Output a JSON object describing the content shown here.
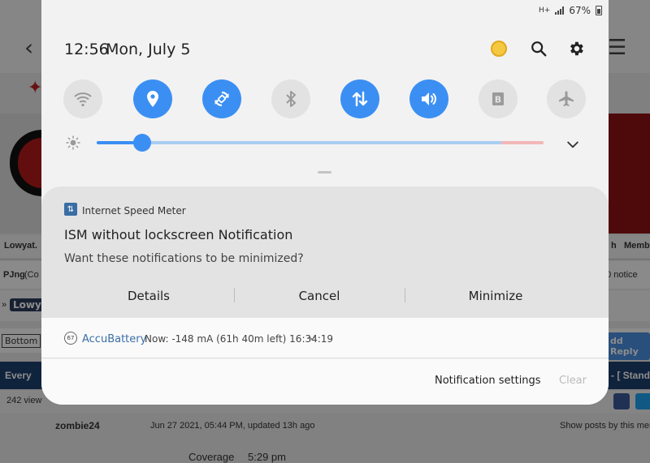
{
  "background": {
    "lowyat": "Lowyat.",
    "right_tab1": "h",
    "right_tab2": "Memb",
    "pjng": "PJng",
    "pjng_suffix": "(Co",
    "notice": "t  0 notice",
    "lowy_chip": "Lowy",
    "bottom_btn": "Bottom",
    "add_reply": "dd Reply",
    "every": "Every",
    "stand": "- [ Stand",
    "views": "242 view",
    "user": "zombie24",
    "posted": "Jun 27 2021, 05:44 PM, updated 13h ago",
    "show_posts": "Show posts by this mem",
    "coverage": "Coverage",
    "coverage_time": "5:29 pm"
  },
  "status_bar": {
    "net_label": "H+",
    "battery": "67%"
  },
  "header": {
    "time": "12:56",
    "date": "Mon, July 5"
  },
  "quick_settings": {
    "toggles": [
      {
        "name": "wifi",
        "state": "off"
      },
      {
        "name": "location",
        "state": "on"
      },
      {
        "name": "auto-rotate",
        "state": "on"
      },
      {
        "name": "bluetooth",
        "state": "off"
      },
      {
        "name": "mobile-data",
        "state": "on"
      },
      {
        "name": "sound",
        "state": "on"
      },
      {
        "name": "blue-light-filter",
        "state": "off"
      },
      {
        "name": "airplane-mode",
        "state": "off"
      }
    ],
    "brightness_fraction": 0.11
  },
  "notifications": [
    {
      "app": "Internet Speed Meter",
      "title": "ISM without lockscreen Notification",
      "text": "Want these notifications to be minimized?",
      "actions": [
        "Details",
        "Cancel",
        "Minimize"
      ]
    },
    {
      "app": "AccuBattery",
      "icon_text": "67",
      "text": "Now: -148 mA (61h 40m left) 16:34:19"
    }
  ],
  "footer": {
    "settings": "Notification settings",
    "clear": "Clear"
  },
  "colors": {
    "accent": "#3b8ff3",
    "panel": "#f2f2f2"
  }
}
